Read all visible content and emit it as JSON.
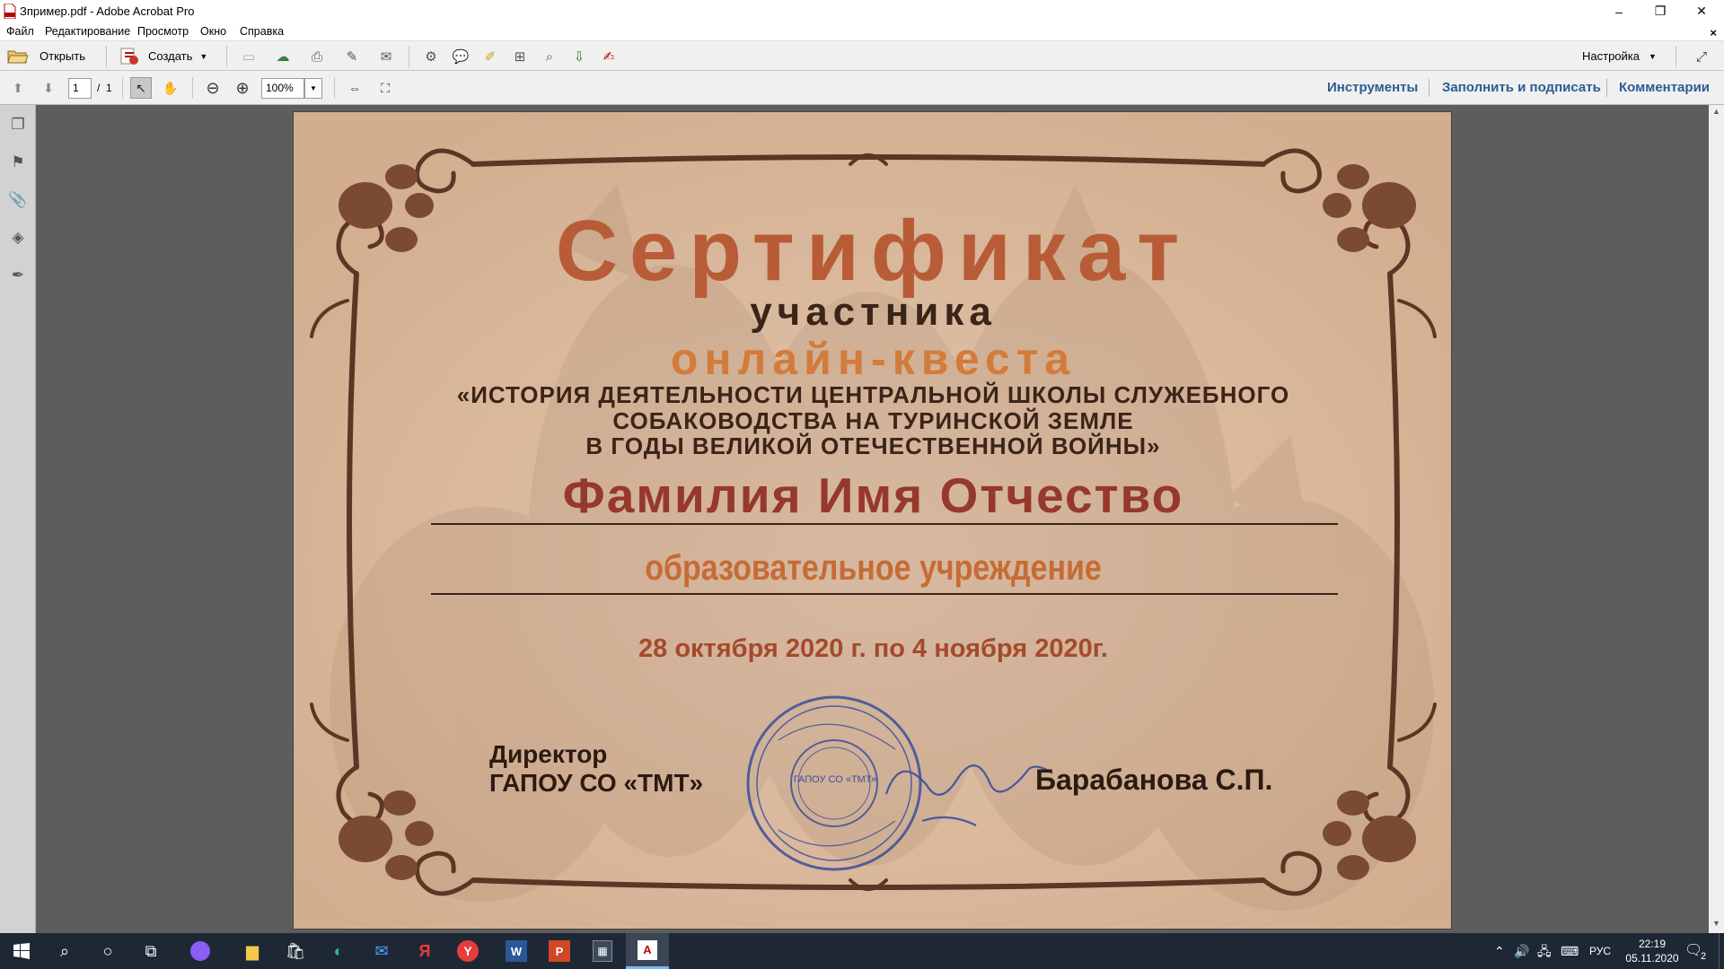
{
  "window": {
    "title": "Зпример.pdf - Adobe Acrobat Pro",
    "minimize": "–",
    "restore": "❐",
    "close": "✕"
  },
  "menu": {
    "items": [
      "Файл",
      "Редактирование",
      "Просмотр",
      "Окно",
      "Справка"
    ],
    "close_doc": "×"
  },
  "toolbar": {
    "open_label": "Открыть",
    "create_label": "Создать",
    "customize_label": "Настройка"
  },
  "navbar": {
    "current_page": "1",
    "page_sep": "/",
    "total_pages": "1",
    "zoom": "100%",
    "links": [
      "Инструменты",
      "Заполнить и подписать",
      "Комментарии"
    ]
  },
  "certificate": {
    "title": "Сертификат",
    "subtitle1": "участника",
    "subtitle2": "онлайн-квеста",
    "topic": [
      "«ИСТОРИЯ ДЕЯТЕЛЬНОСТИ ЦЕНТРАЛЬНОЙ ШКОЛЫ СЛУЖЕБНОГО",
      "СОБАКОВОДСТВА НА ТУРИНСКОЙ ЗЕМЛЕ",
      "В ГОДЫ ВЕЛИКОЙ ОТЕЧЕСТВЕННОЙ ВОЙНЫ»"
    ],
    "name": "Фамилия Имя Отчество",
    "organization": "образовательное учреждение",
    "dates": "28 октября 2020 г. по 4 ноября 2020г.",
    "director_line1": "Директор",
    "director_line2": "ГАПОУ СО «ТМТ»",
    "signer": "Барабанова С.П.",
    "stamp_text": "ГАПОУ СО «ТМТ»"
  },
  "taskbar": {
    "language": "РУС",
    "time": "22:19",
    "date": "05.11.2020",
    "notifications": "2"
  },
  "colors": {
    "certificate_bg": "#dfc1a6",
    "title": "#b85c38",
    "accent_orange": "#d37b3a",
    "name": "#96382c",
    "dark_brown": "#3b2418",
    "link_blue": "#2b5d93",
    "stamp_blue": "#3a4f9c"
  }
}
